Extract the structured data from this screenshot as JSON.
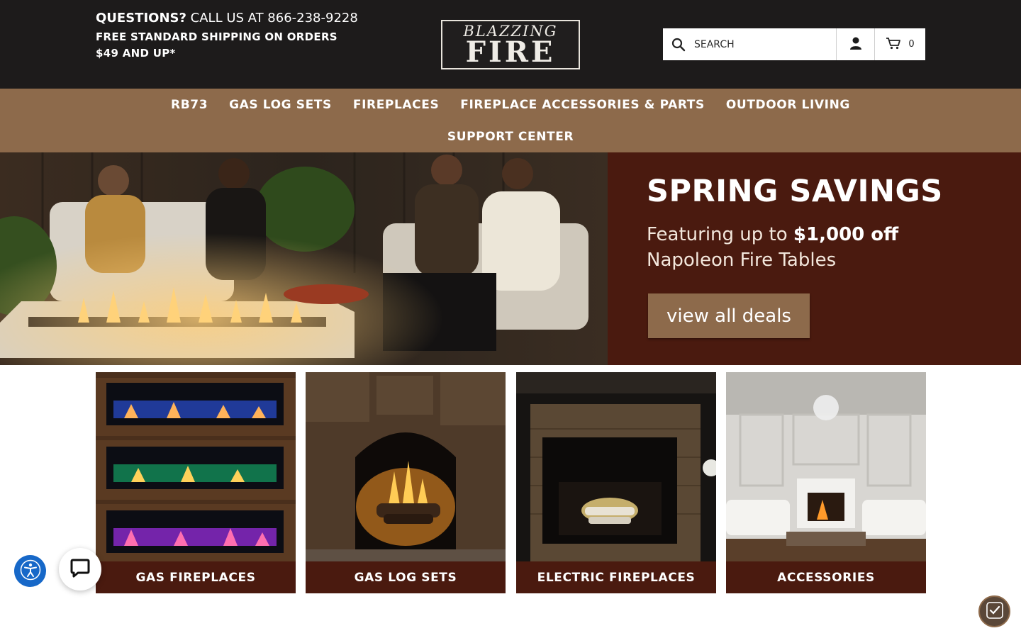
{
  "header": {
    "questions_label": "QUESTIONS?",
    "call_text": "CALL US AT 866-238-9228",
    "shipping_text": "FREE STANDARD SHIPPING ON ORDERS $49 AND UP*",
    "logo_line1": "BLAZZING",
    "logo_line2": "FIRE",
    "search_placeholder": "SEARCH",
    "cart_count": "0",
    "icons": {
      "search": "search-icon",
      "account": "user-icon",
      "cart": "cart-icon"
    }
  },
  "nav": {
    "row1": [
      "RB73",
      "GAS LOG SETS",
      "FIREPLACES",
      "FIREPLACE ACCESSORIES & PARTS",
      "OUTDOOR LIVING"
    ],
    "row2": [
      "SUPPORT CENTER"
    ]
  },
  "hero": {
    "title": "SPRING SAVINGS",
    "sub_prefix": "Featuring up to ",
    "sub_highlight": "$1,000 off",
    "sub_line2": "Napoleon Fire Tables",
    "button": "view all deals"
  },
  "categories": [
    {
      "label": "GAS FIREPLACES"
    },
    {
      "label": "GAS LOG SETS"
    },
    {
      "label": "ELECTRIC FIREPLACES"
    },
    {
      "label": "ACCESSORIES"
    }
  ],
  "widgets": {
    "accessibility": "accessibility-icon",
    "chat": "chat-icon",
    "trust": "shield-check-icon"
  },
  "colors": {
    "header_bg": "#1d1b1b",
    "nav_bg": "#8d6a4b",
    "hero_bg": "#4a1a0f",
    "accent_blue": "#1768c8"
  }
}
